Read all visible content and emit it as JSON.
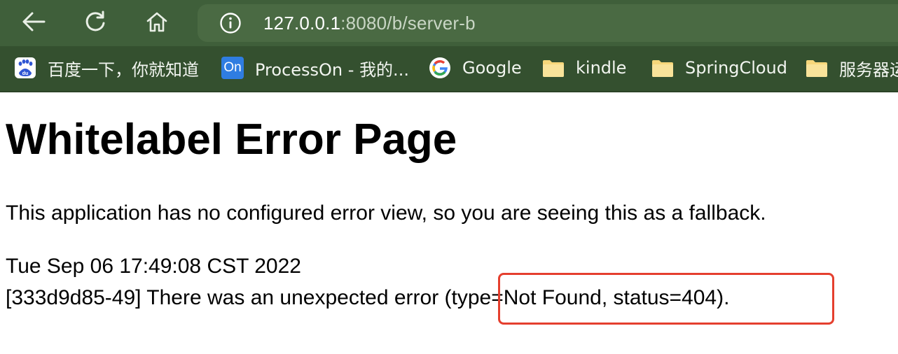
{
  "browser": {
    "url_host": "127.0.0.1",
    "url_rest": ":8080/b/server-b",
    "icons": {
      "back": "back-arrow-icon",
      "reload": "reload-icon",
      "home": "home-icon",
      "info": "info-icon"
    }
  },
  "bookmarks": [
    {
      "label": "百度一下，你就知道",
      "icon": "baidu-icon"
    },
    {
      "label": "ProcessOn - 我的...",
      "icon": "processon-icon",
      "icon_text": "On"
    },
    {
      "label": "Google",
      "icon": "google-icon"
    },
    {
      "label": "kindle",
      "icon": "folder-icon"
    },
    {
      "label": "SpringCloud",
      "icon": "folder-icon"
    },
    {
      "label": "服务器运",
      "icon": "folder-icon"
    }
  ],
  "page": {
    "title": "Whitelabel Error Page",
    "description": "This application has no configured error view, so you are seeing this as a fallback.",
    "timestamp": "Tue Sep 06 17:49:08 CST 2022",
    "error_message": "[333d9d85-49] There was an unexpected error (type=Not Found, status=404)."
  },
  "colors": {
    "toolbar": "#3f5f3a",
    "bookmarks_bar": "#34502f",
    "highlight": "#e53f2e"
  }
}
